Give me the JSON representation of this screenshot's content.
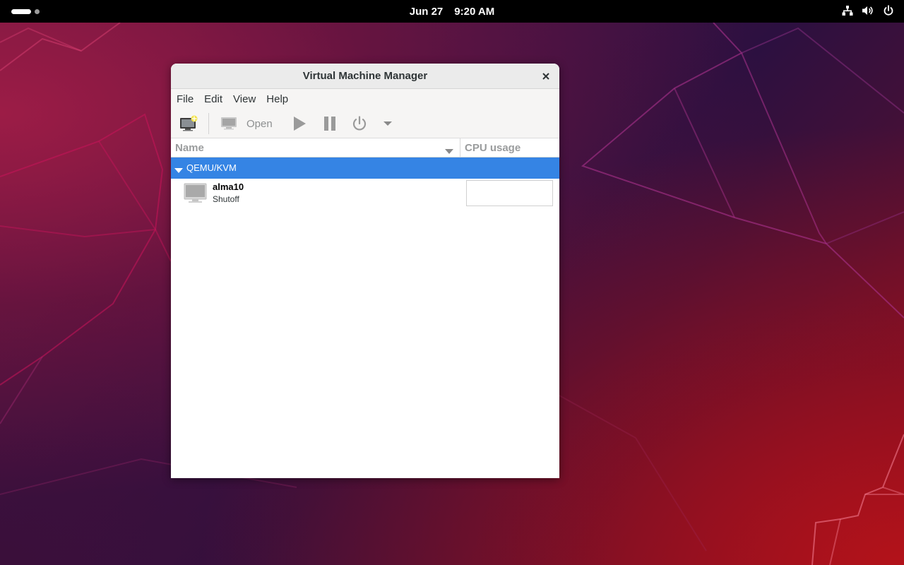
{
  "topbar": {
    "date": "Jun 27",
    "time": "9:20 AM",
    "icons": [
      "network-wired-icon",
      "volume-icon",
      "power-icon"
    ]
  },
  "window": {
    "title": "Virtual Machine Manager",
    "close_icon": "close-icon"
  },
  "menubar": {
    "items": [
      "File",
      "Edit",
      "View",
      "Help"
    ]
  },
  "toolbar": {
    "new_vm_icon": "new-vm-icon",
    "open_label": "Open",
    "run_icon": "play-icon",
    "pause_icon": "pause-icon",
    "shutdown_icon": "power-icon",
    "shutdown_menu_icon": "chevron-down-icon"
  },
  "table": {
    "columns": [
      "Name",
      "CPU usage"
    ],
    "group": {
      "label": "QEMU/KVM",
      "expanded": true
    },
    "vms": [
      {
        "name": "alma10",
        "status": "Shutoff",
        "icon": "monitor-icon"
      }
    ]
  },
  "colors": {
    "accent": "#3584e4",
    "topbar": "#000000",
    "window_bg": "#f6f5f4"
  }
}
